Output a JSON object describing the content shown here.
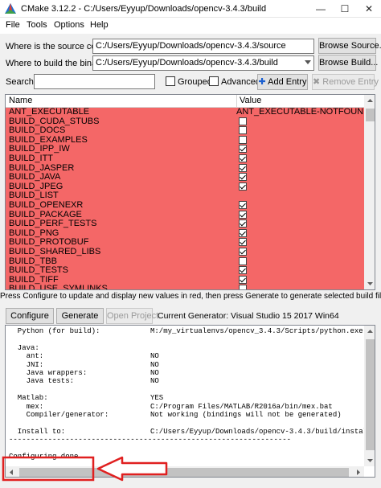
{
  "window": {
    "title": "CMake 3.12.2 - C:/Users/Eyyup/Downloads/opencv-3.4.3/build"
  },
  "menu": [
    "File",
    "Tools",
    "Options",
    "Help"
  ],
  "source": {
    "label": "Where is the source code:",
    "value": "C:/Users/Eyyup/Downloads/opencv-3.4.3/source",
    "browse": "Browse Source..."
  },
  "build": {
    "label": "Where to build the binaries:",
    "value": "C:/Users/Eyyup/Downloads/opencv-3.4.3/build",
    "browse": "Browse Build..."
  },
  "search": {
    "label": "Search:",
    "value": "",
    "grouped": "Grouped",
    "advanced": "Advanced",
    "add": "Add Entry",
    "remove": "Remove Entry"
  },
  "table": {
    "headers": [
      "Name",
      "Value"
    ],
    "row_color": "#f46767",
    "rows": [
      {
        "name": "ANT_EXECUTABLE",
        "text": "ANT_EXECUTABLE-NOTFOUND"
      },
      {
        "name": "BUILD_CUDA_STUBS",
        "checked": false
      },
      {
        "name": "BUILD_DOCS",
        "checked": false
      },
      {
        "name": "BUILD_EXAMPLES",
        "checked": false
      },
      {
        "name": "BUILD_IPP_IW",
        "checked": true
      },
      {
        "name": "BUILD_ITT",
        "checked": true
      },
      {
        "name": "BUILD_JASPER",
        "checked": true
      },
      {
        "name": "BUILD_JAVA",
        "checked": true
      },
      {
        "name": "BUILD_JPEG",
        "checked": true
      },
      {
        "name": "BUILD_LIST",
        "text": ""
      },
      {
        "name": "BUILD_OPENEXR",
        "checked": true
      },
      {
        "name": "BUILD_PACKAGE",
        "checked": true
      },
      {
        "name": "BUILD_PERF_TESTS",
        "checked": true
      },
      {
        "name": "BUILD_PNG",
        "checked": true
      },
      {
        "name": "BUILD_PROTOBUF",
        "checked": true
      },
      {
        "name": "BUILD_SHARED_LIBS",
        "checked": true
      },
      {
        "name": "BUILD_TBB",
        "checked": false
      },
      {
        "name": "BUILD_TESTS",
        "checked": true
      },
      {
        "name": "BUILD_TIFF",
        "checked": true
      },
      {
        "name": "BUILD_USE_SYMLINKS",
        "checked": false
      }
    ]
  },
  "hint": "Press Configure to update and display new values in red, then press Generate to generate selected build files.",
  "actions": {
    "configure": "Configure",
    "generate": "Generate",
    "open_project": "Open Project",
    "generator": "Current Generator: Visual Studio 15 2017 Win64"
  },
  "output": [
    {
      "k": "  Python (for build):",
      "v": "M:/my_virtualenvs/opencv_3.4.3/Scripts/python.exe"
    },
    {
      "k": "",
      "v": ""
    },
    {
      "k": "  Java:",
      "v": ""
    },
    {
      "k": "    ant:",
      "v": "NO"
    },
    {
      "k": "    JNI:",
      "v": "NO"
    },
    {
      "k": "    Java wrappers:",
      "v": "NO"
    },
    {
      "k": "    Java tests:",
      "v": "NO"
    },
    {
      "k": "",
      "v": ""
    },
    {
      "k": "  Matlab:",
      "v": "YES"
    },
    {
      "k": "    mex:",
      "v": "C:/Program Files/MATLAB/R2016a/bin/mex.bat"
    },
    {
      "k": "    Compiler/generator:",
      "v": "Not working (bindings will not be generated)"
    },
    {
      "k": "",
      "v": ""
    },
    {
      "k": "  Install to:",
      "v": "C:/Users/Eyyup/Downloads/opencv-3.4.3/build/install"
    },
    {
      "k": "-----------------------------------------------------------------",
      "v": ""
    },
    {
      "k": "",
      "v": ""
    },
    {
      "k": "Configuring done",
      "v": ""
    }
  ],
  "accent": "#e02020",
  "icons": {
    "minimize": "minimize-icon",
    "maximize": "maximize-icon",
    "close": "close-icon",
    "add": "plus-icon",
    "remove": "x-icon",
    "callout": "arrow-callout"
  }
}
